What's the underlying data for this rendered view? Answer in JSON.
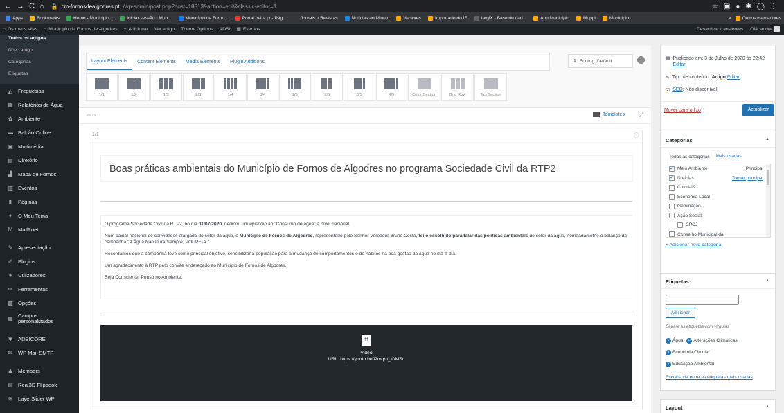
{
  "browser": {
    "url_host": "cm-fornosdealgodres.pt",
    "url_path": "/wp-admin/post.php?post=18813&action=edit&classic-editor=1",
    "bookmarks": [
      {
        "label": "Apps",
        "color": "#4285f4"
      },
      {
        "label": "Bookmarks",
        "color": "#fbbc04"
      },
      {
        "label": "Home - Município...",
        "color": "#34a853"
      },
      {
        "label": "Iniciar sessão ‹ Mun...",
        "color": "#34a853"
      },
      {
        "label": "Município de Forno...",
        "color": "#1877f2"
      },
      {
        "label": "Portal beira.pt - Pág...",
        "color": "#e53935"
      },
      {
        "label": "Jornais e Revistas",
        "color": "#35363a"
      },
      {
        "label": "Notícias ao Minuto",
        "color": "#1e88e5"
      },
      {
        "label": "Vectores",
        "color": "#f9ab00"
      },
      {
        "label": "Importado do IE",
        "color": "#f9ab00"
      },
      {
        "label": "LegiX - Base de dad...",
        "color": "#5f6368"
      },
      {
        "label": "App Município",
        "color": "#f9ab00"
      },
      {
        "label": "Muppi",
        "color": "#f9ab00"
      },
      {
        "label": "Município",
        "color": "#f9ab00"
      }
    ],
    "more": "»",
    "other_bookmarks": "Outros marcadores"
  },
  "adminbar": {
    "sites": "Os meus sites",
    "site_name": "Município de Fornos de Algodres",
    "add": "Adicionar",
    "view_post": "Ver artigo",
    "theme_options": "Theme Options",
    "adsi": "ADSI",
    "events": "Eventos",
    "transients": "Desactivar transientes",
    "greeting": "Olá, andre"
  },
  "sidebar": {
    "sub_items": [
      "Todos os artigos",
      "Novo artigo",
      "Categorias",
      "Etiquetas"
    ],
    "items": [
      {
        "label": "Freguesias",
        "icon": "◭"
      },
      {
        "label": "Relatórios de Água",
        "icon": "▦"
      },
      {
        "label": "Ambiente",
        "icon": "✿"
      },
      {
        "label": "Balcão Online",
        "icon": "▬"
      },
      {
        "label": "Multimédia",
        "icon": "▣"
      },
      {
        "label": "Diretório",
        "icon": "▤"
      },
      {
        "label": "Mapa de Fornos",
        "icon": "▟"
      },
      {
        "label": "Eventos",
        "icon": "▥"
      },
      {
        "label": "Páginas",
        "icon": "▮"
      },
      {
        "label": "O Meu Tema",
        "icon": "✦"
      },
      {
        "label": "MailPoet",
        "icon": "M"
      },
      {
        "label": "Apresentação",
        "icon": "✎"
      },
      {
        "label": "Plugins",
        "icon": "✐"
      },
      {
        "label": "Utilizadores",
        "icon": "●"
      },
      {
        "label": "Ferramentas",
        "icon": "✑"
      },
      {
        "label": "Opções",
        "icon": "▩"
      },
      {
        "label": "Campos personalizados",
        "icon": "▦"
      },
      {
        "label": "ADSICORE",
        "icon": "✱"
      },
      {
        "label": "WP Mail SMTP",
        "icon": "✉"
      },
      {
        "label": "Members",
        "icon": "♟"
      },
      {
        "label": "Real3D Flipbook",
        "icon": "▤"
      },
      {
        "label": "LayerSlider WP",
        "icon": "≋"
      }
    ]
  },
  "builder": {
    "tabs": [
      "Layout Elements",
      "Content Elements",
      "Media Elements",
      "Plugin Additions"
    ],
    "sorting": "Sorting: Default",
    "elements": [
      {
        "label": "1/1",
        "bars": [
          20
        ]
      },
      {
        "label": "1/2",
        "bars": [
          9,
          9
        ]
      },
      {
        "label": "1/3",
        "bars": [
          6,
          6,
          6
        ]
      },
      {
        "label": "2/3",
        "bars": [
          12,
          6
        ]
      },
      {
        "label": "1/4",
        "bars": [
          4,
          4,
          4,
          4
        ]
      },
      {
        "label": "3/4",
        "bars": [
          14,
          4
        ]
      },
      {
        "label": "1/5",
        "bars": [
          3,
          3,
          3,
          3,
          3
        ]
      },
      {
        "label": "2/5",
        "bars": [
          8,
          3,
          3
        ]
      },
      {
        "label": "3/5",
        "bars": [
          12,
          3
        ]
      },
      {
        "label": "4/5",
        "bars": [
          16,
          3
        ]
      },
      {
        "label": "Color Section",
        "bars": [
          20
        ]
      },
      {
        "label": "Grid Row",
        "bars": [
          6,
          6,
          6
        ]
      },
      {
        "label": "Tab Section",
        "bars": [
          20
        ]
      }
    ],
    "undo": "↶ ↷",
    "templates": "Templates"
  },
  "content": {
    "section_label": "1/1",
    "title": "Boas práticas ambientais do Município de Fornos de Algodres no programa Sociedade Civil da RTP2",
    "p1_a": "O programa Sociedade Civil da RTP2, no dia ",
    "p1_date": "01/07/2020",
    "p1_b": ", dedicou um episódio ao \"Consumo de água\" a nível nacional.",
    "p2_a": "Num painel nacional de convidados alargado do setor da água, o ",
    "p2_bold": "Município de Fornos de Algodres",
    "p2_b": ", representado pelo Senhor Vereador Bruno Costa, ",
    "p2_bold2": "foi o escolhido para falar das políticas ambientais",
    "p2_c": " do setor da água, nomeadametne o balanço da campanha \"A Água Não Dura Sempre, POUPE-A.\".",
    "p3": "Recordamos que a campanha teve como principal objetivo, sensibilizar a população para a mudança de comportamentos e de hábitos na boa gestão da água no dia-a-dia.",
    "p4": "Um agradecimento à RTP pelo convite endereçado ao Município de Fornos de Algodres.",
    "p5": "Seja Consciente, Penso no Ambiente.",
    "video_label": "Video",
    "video_url": "URL: https://youtu.be/l2mqm_lOMSc"
  },
  "publish": {
    "published_label": "Publicado em: ",
    "published_date": "3 de Julho de 2020 às 22:42",
    "edit": "Editar",
    "type_label": "Tipo de conteúdo: ",
    "type_value": "Artigo",
    "seo_label": "SEO",
    "seo_value": ": Não disponível",
    "trash": "Mover para o lixo",
    "update": "Actualizar"
  },
  "categories": {
    "title": "Categorias",
    "tab_all": "Todas as categorias",
    "tab_used": "Mais usadas",
    "items": [
      {
        "label": "Meio Ambiente",
        "checked": "✓",
        "right": "Principal",
        "indent": false
      },
      {
        "label": "Notícias",
        "checked": "✓",
        "right": "Tornar principal",
        "indent": false
      },
      {
        "label": "Covid-19",
        "checked": "",
        "right": "",
        "indent": false
      },
      {
        "label": "Economia Local",
        "checked": "",
        "right": "",
        "indent": false
      },
      {
        "label": "Geminação",
        "checked": "",
        "right": "",
        "indent": false
      },
      {
        "label": "Ação Social",
        "checked": "",
        "right": "",
        "indent": false
      },
      {
        "label": "CPCJ",
        "checked": "",
        "right": "",
        "indent": true
      },
      {
        "label": "Conselho Municipal da",
        "checked": "",
        "right": "",
        "indent": false
      }
    ],
    "add_new": "+ Adicionar nova categoria"
  },
  "tags": {
    "title": "Etiquetas",
    "add": "Adicionar",
    "hint": "Separe as etiquetas com vírgulas",
    "items": [
      "Água",
      "Alterações Climáticas",
      "Economia Circular",
      "Educação Ambiental"
    ],
    "more": "Escolha de entre as etiquetas mais usadas"
  },
  "layout": {
    "title": "Layout"
  }
}
